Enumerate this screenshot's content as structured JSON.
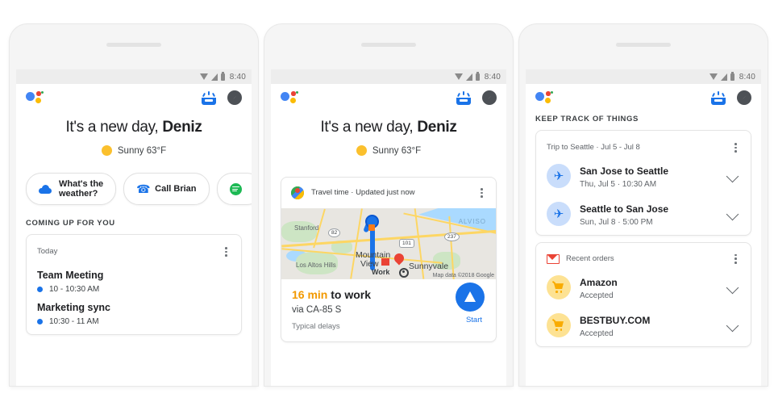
{
  "status_bar": {
    "time": "8:40",
    "icons": [
      "wifi-icon",
      "signal-icon",
      "battery-icon"
    ]
  },
  "app_bar": {
    "assistant_logo": "google-assistant-logo",
    "snapshot_icon": "snapshot-tray-icon",
    "explore_icon": "explore-compass-icon"
  },
  "phone1": {
    "greeting_prefix": "It's a new day, ",
    "greeting_name": "Deniz",
    "weather": "Sunny 63°F",
    "chips": [
      {
        "icon": "cloud-icon",
        "label": "What's the\nweather?",
        "line1": "What's the",
        "line2": "weather?"
      },
      {
        "icon": "phone-icon",
        "label": "Call Brian"
      },
      {
        "icon": "spotify-icon",
        "label": ""
      }
    ],
    "section_label": "COMING UP FOR YOU",
    "card": {
      "header": "Today",
      "menu": "more-options",
      "events": [
        {
          "title": "Team Meeting",
          "time": "10 - 10:30 AM"
        },
        {
          "title": "Marketing sync",
          "time": "10:30 - 11 AM"
        }
      ]
    }
  },
  "phone2": {
    "greeting_prefix": "It's a new day, ",
    "greeting_name": "Deniz",
    "weather": "Sunny 63°F",
    "travel_card": {
      "header": "Travel time · Updated just now",
      "header_icon": "google-maps-icon",
      "menu": "more-options",
      "map": {
        "labels": [
          "Stanford",
          "Los Altos Hills",
          "Mountain",
          "View",
          "Sunnyvale",
          "ALVISO",
          "Work"
        ],
        "shields": [
          "82",
          "101",
          "237"
        ],
        "attribution": "Map data ©2018 Google",
        "origin_marker": "origin-dot",
        "destination_marker": "destination-pin"
      },
      "duration": "16 min",
      "duration_suffix": " to work",
      "via": "via CA-85 S",
      "delays": "Typical delays",
      "start_label": "Start",
      "fab_icon": "navigation-arrow-icon"
    }
  },
  "phone3": {
    "section_label": "KEEP TRACK OF THINGS",
    "trip_card": {
      "header": "Trip to Seattle · Jul 5 - Jul 8",
      "menu": "more-options",
      "rows": [
        {
          "icon": "airplane-icon",
          "title": "San Jose to Seattle",
          "sub": "Thu, Jul 5 · 10:30 AM",
          "chevron": "chevron-down-icon"
        },
        {
          "icon": "airplane-icon",
          "title": "Seattle to San Jose",
          "sub": "Sun, Jul 8 · 5:00 PM",
          "chevron": "chevron-down-icon"
        }
      ]
    },
    "orders_card": {
      "header": "Recent orders",
      "header_icon": "gmail-icon",
      "menu": "more-options",
      "rows": [
        {
          "icon": "shopping-cart-icon",
          "title": "Amazon",
          "sub": "Accepted",
          "chevron": "chevron-down-icon"
        },
        {
          "icon": "shopping-cart-icon",
          "title": "BESTBUY.COM",
          "sub": "Accepted",
          "chevron": "chevron-down-icon"
        }
      ]
    }
  },
  "colors": {
    "blue": "#1a73e8",
    "red": "#ea4335",
    "yellow": "#fbbc04",
    "green": "#34a853",
    "orange": "#f29900",
    "text": "#202124",
    "subtext": "#5f6368"
  }
}
